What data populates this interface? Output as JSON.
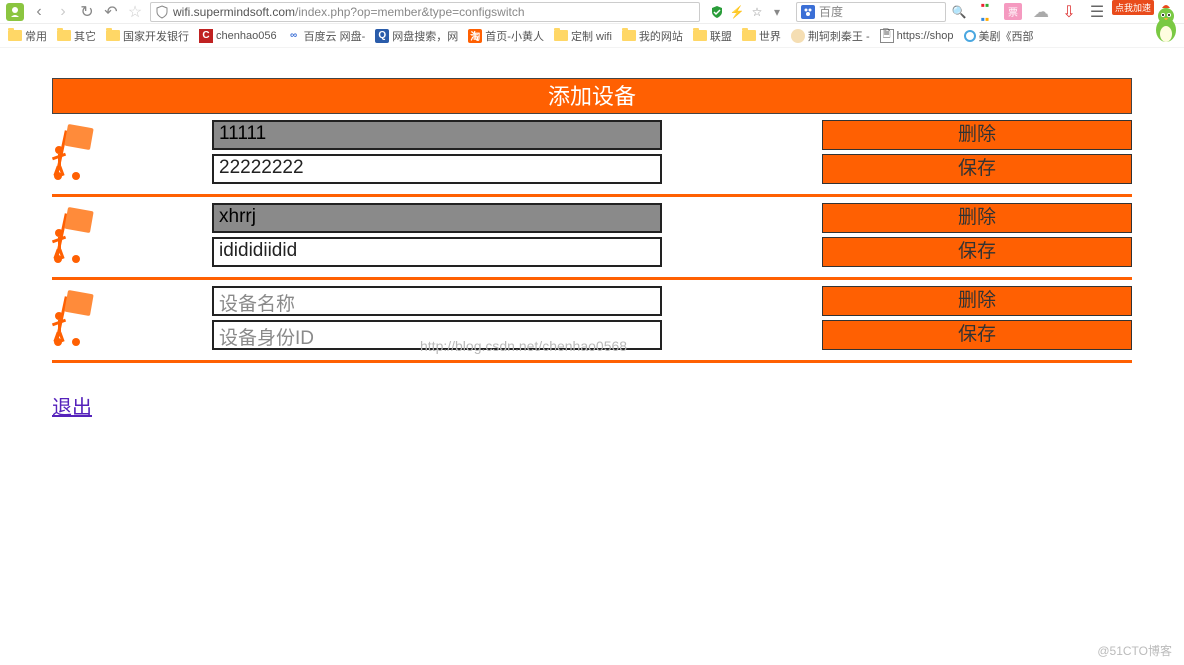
{
  "browser": {
    "url_host": "wifi.supermindsoft.com",
    "url_path": "/index.php?op=member&type=configswitch",
    "search_engine": "百度",
    "badge_text": "点我加速"
  },
  "bookmarks": [
    {
      "icon": "fold",
      "label": "常用"
    },
    {
      "icon": "fold",
      "label": "其它"
    },
    {
      "icon": "fold",
      "label": "国家开发银行"
    },
    {
      "icon": "c",
      "label": "chenhao056"
    },
    {
      "icon": "bd",
      "label": "百度云 网盘-"
    },
    {
      "icon": "q",
      "label": "网盘搜索，网"
    },
    {
      "icon": "tao",
      "label": "首页-小黄人"
    },
    {
      "icon": "fold",
      "label": "定制 wifi"
    },
    {
      "icon": "fold",
      "label": "我的网站"
    },
    {
      "icon": "fold",
      "label": "联盟"
    },
    {
      "icon": "fold",
      "label": "世界"
    },
    {
      "icon": "face",
      "label": "荆轲刺秦王 -"
    },
    {
      "icon": "doc",
      "label": "https://shop"
    },
    {
      "icon": "tv",
      "label": "美剧《西部"
    }
  ],
  "page_title": "添加设备",
  "rows": [
    {
      "name": "11111",
      "id": "22222222",
      "filled": true
    },
    {
      "name": "xhrrj",
      "id": "idididiidid",
      "filled": true
    },
    {
      "name": "",
      "id": "",
      "filled": false
    }
  ],
  "placeholders": {
    "name": "设备名称",
    "id": "设备身份ID"
  },
  "buttons": {
    "delete": "删除",
    "save": "保存"
  },
  "logout": "退出",
  "watermark_center": "http://blog.csdn.net/chenhao0568",
  "watermark_corner": "@51CTO博客"
}
